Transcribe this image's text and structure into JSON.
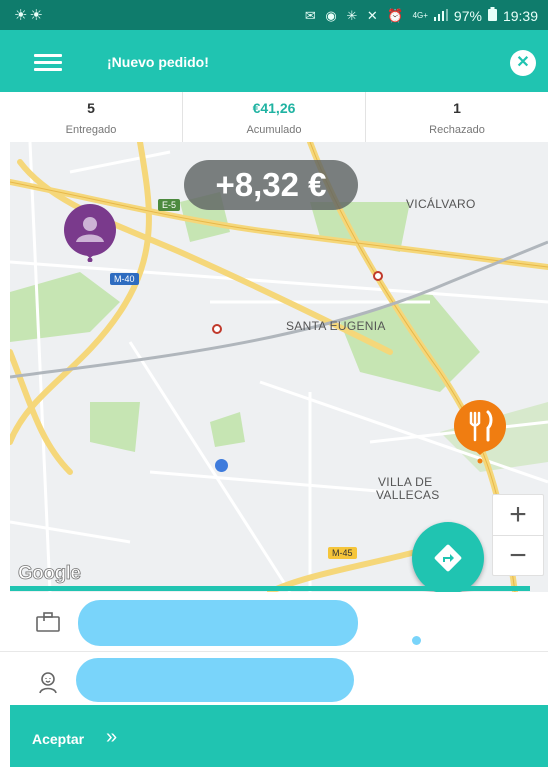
{
  "status_bar": {
    "left_icons": "☀☀",
    "right_icons": "✉ ◉ ✳ ✕ ⏰",
    "network": "4G+",
    "battery": "97%",
    "time": "19:39"
  },
  "app_bar": {
    "title": "¡Nuevo pedido!",
    "menu_icon": "hamburger-menu-icon",
    "close_icon": "close-icon"
  },
  "stats": [
    {
      "value": "5",
      "label": "Entregado"
    },
    {
      "value": "€41,26",
      "label": "Acumulado"
    },
    {
      "value": "1",
      "label": "Rechazado"
    }
  ],
  "map": {
    "earnings_badge": "+8,32 €",
    "labels": {
      "vicalvaro": "VICÁLVARO",
      "santa_eugenia": "SANTA EUGENIA",
      "villa_de_vallecas_1": "VILLA DE",
      "villa_de_vallecas_2": "VALLECAS"
    },
    "road_shields": {
      "e5": "E-5",
      "m40": "M-40",
      "m45": "M-45"
    },
    "zoom_in": "+",
    "zoom_out": "−",
    "attribution": "Google",
    "accent_color": "#20c4b1",
    "pickup_color": "#f07d11",
    "customer_color": "#7a3a8c"
  },
  "details": {
    "row1_icon": "briefcase-icon",
    "row2_icon": "person-icon"
  },
  "footer": {
    "accept_label": "Aceptar",
    "accept_chevrons": "»"
  }
}
